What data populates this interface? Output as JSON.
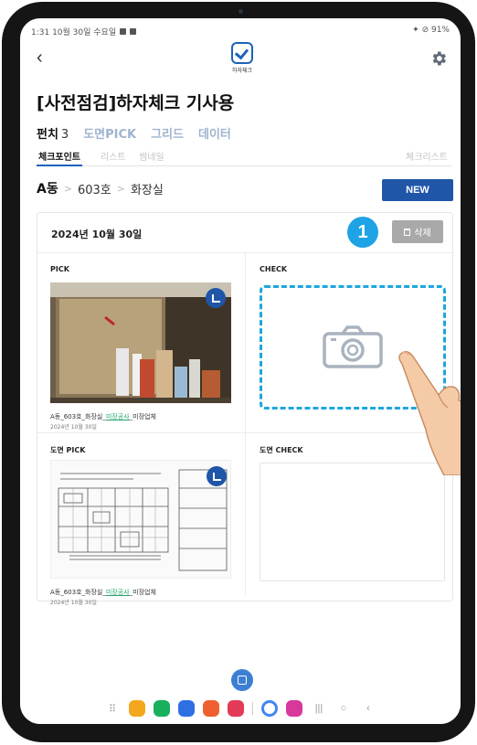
{
  "status_bar": {
    "left_text": "1:31 10월 30일 수요일",
    "right_text": "91%"
  },
  "app": {
    "logo_text": "하자체크"
  },
  "page_title": "[사전점검]하자체크 기사용",
  "tabs": [
    {
      "label": "펀치",
      "count": "3",
      "active": true
    },
    {
      "label": "도면PICK"
    },
    {
      "label": "그리드"
    },
    {
      "label": "데이터"
    }
  ],
  "subtabs": {
    "checkpoint": "체크포인트",
    "list": "리스트",
    "thumbnail": "썸네일",
    "checklist": "체크리스트"
  },
  "breadcrumb": {
    "building": "A동",
    "unit": "603호",
    "room": "화장실"
  },
  "new_button": "NEW",
  "card": {
    "date": "2024년 10월 30일",
    "step_number": "1",
    "delete_label": "삭제",
    "pick_label": "PICK",
    "check_label": "CHECK",
    "plan_pick_label": "도면 PICK",
    "plan_check_label": "도면 CHECK",
    "caption_prefix": "A동_603호_화장실_",
    "caption_highlight": "미장공사",
    "caption_suffix": "_미장업체",
    "caption_date_1": "2024년 10월 30일",
    "caption_date_2": "2024년 10월 30일"
  },
  "icons": {
    "back": "chevron-left-icon",
    "settings": "gear-icon",
    "camera": "camera-icon",
    "crop": "crop-icon",
    "trash": "trash-icon"
  },
  "colors": {
    "primary": "#1f56a8",
    "accent_cyan": "#1ea6dd",
    "highlight_green": "#23a56a"
  }
}
